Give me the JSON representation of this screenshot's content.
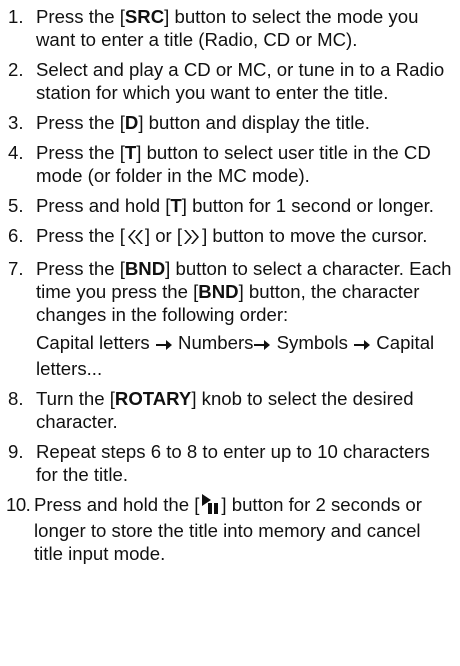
{
  "steps": [
    {
      "number": "1.",
      "parts": [
        "Press the [",
        "SRC",
        "] button to select the mode you want to enter a title (Radio, CD or MC)."
      ]
    },
    {
      "number": "2.",
      "parts": [
        "Select and play a CD or MC, or tune in to a Radio station for which you want to enter the title."
      ]
    },
    {
      "number": "3.",
      "parts": [
        "Press the [",
        "D",
        "] button and display the title."
      ]
    },
    {
      "number": "4.",
      "parts": [
        "Press the [",
        "T",
        "] button to select user title in the CD mode (or folder in the MC mode)."
      ]
    },
    {
      "number": "5.",
      "parts": [
        "Press and hold [",
        "T",
        "] button for 1 second or longer."
      ]
    },
    {
      "number": "6.",
      "parts": [
        "Press the [",
        "] or [",
        "] button to move the cursor."
      ],
      "icons": [
        "rewind-icon",
        "fast-forward-icon"
      ]
    },
    {
      "number": "7.",
      "parts": [
        "Press the [",
        "BND",
        "] button to select a character. Each time you press the [",
        "BND",
        "] button, the character changes in the following order:"
      ],
      "order_line": {
        "item1": "Capital letters",
        "item2": "Numbers",
        "item3": "Symbols",
        "item4": "Capital letters...",
        "arrow_icon": "right-arrow-icon"
      }
    },
    {
      "number": "8.",
      "parts": [
        "Turn the [",
        "ROTARY",
        "] knob to select the desired character."
      ]
    },
    {
      "number": "9.",
      "parts": [
        "Repeat steps 6 to 8 to enter up to 10 characters for the title."
      ]
    },
    {
      "number": "10.",
      "parts": [
        "Press and hold the [",
        "] button for 2 seconds or longer to store the title into memory and cancel title input mode."
      ],
      "icons": [
        "play-pause-icon"
      ]
    }
  ]
}
